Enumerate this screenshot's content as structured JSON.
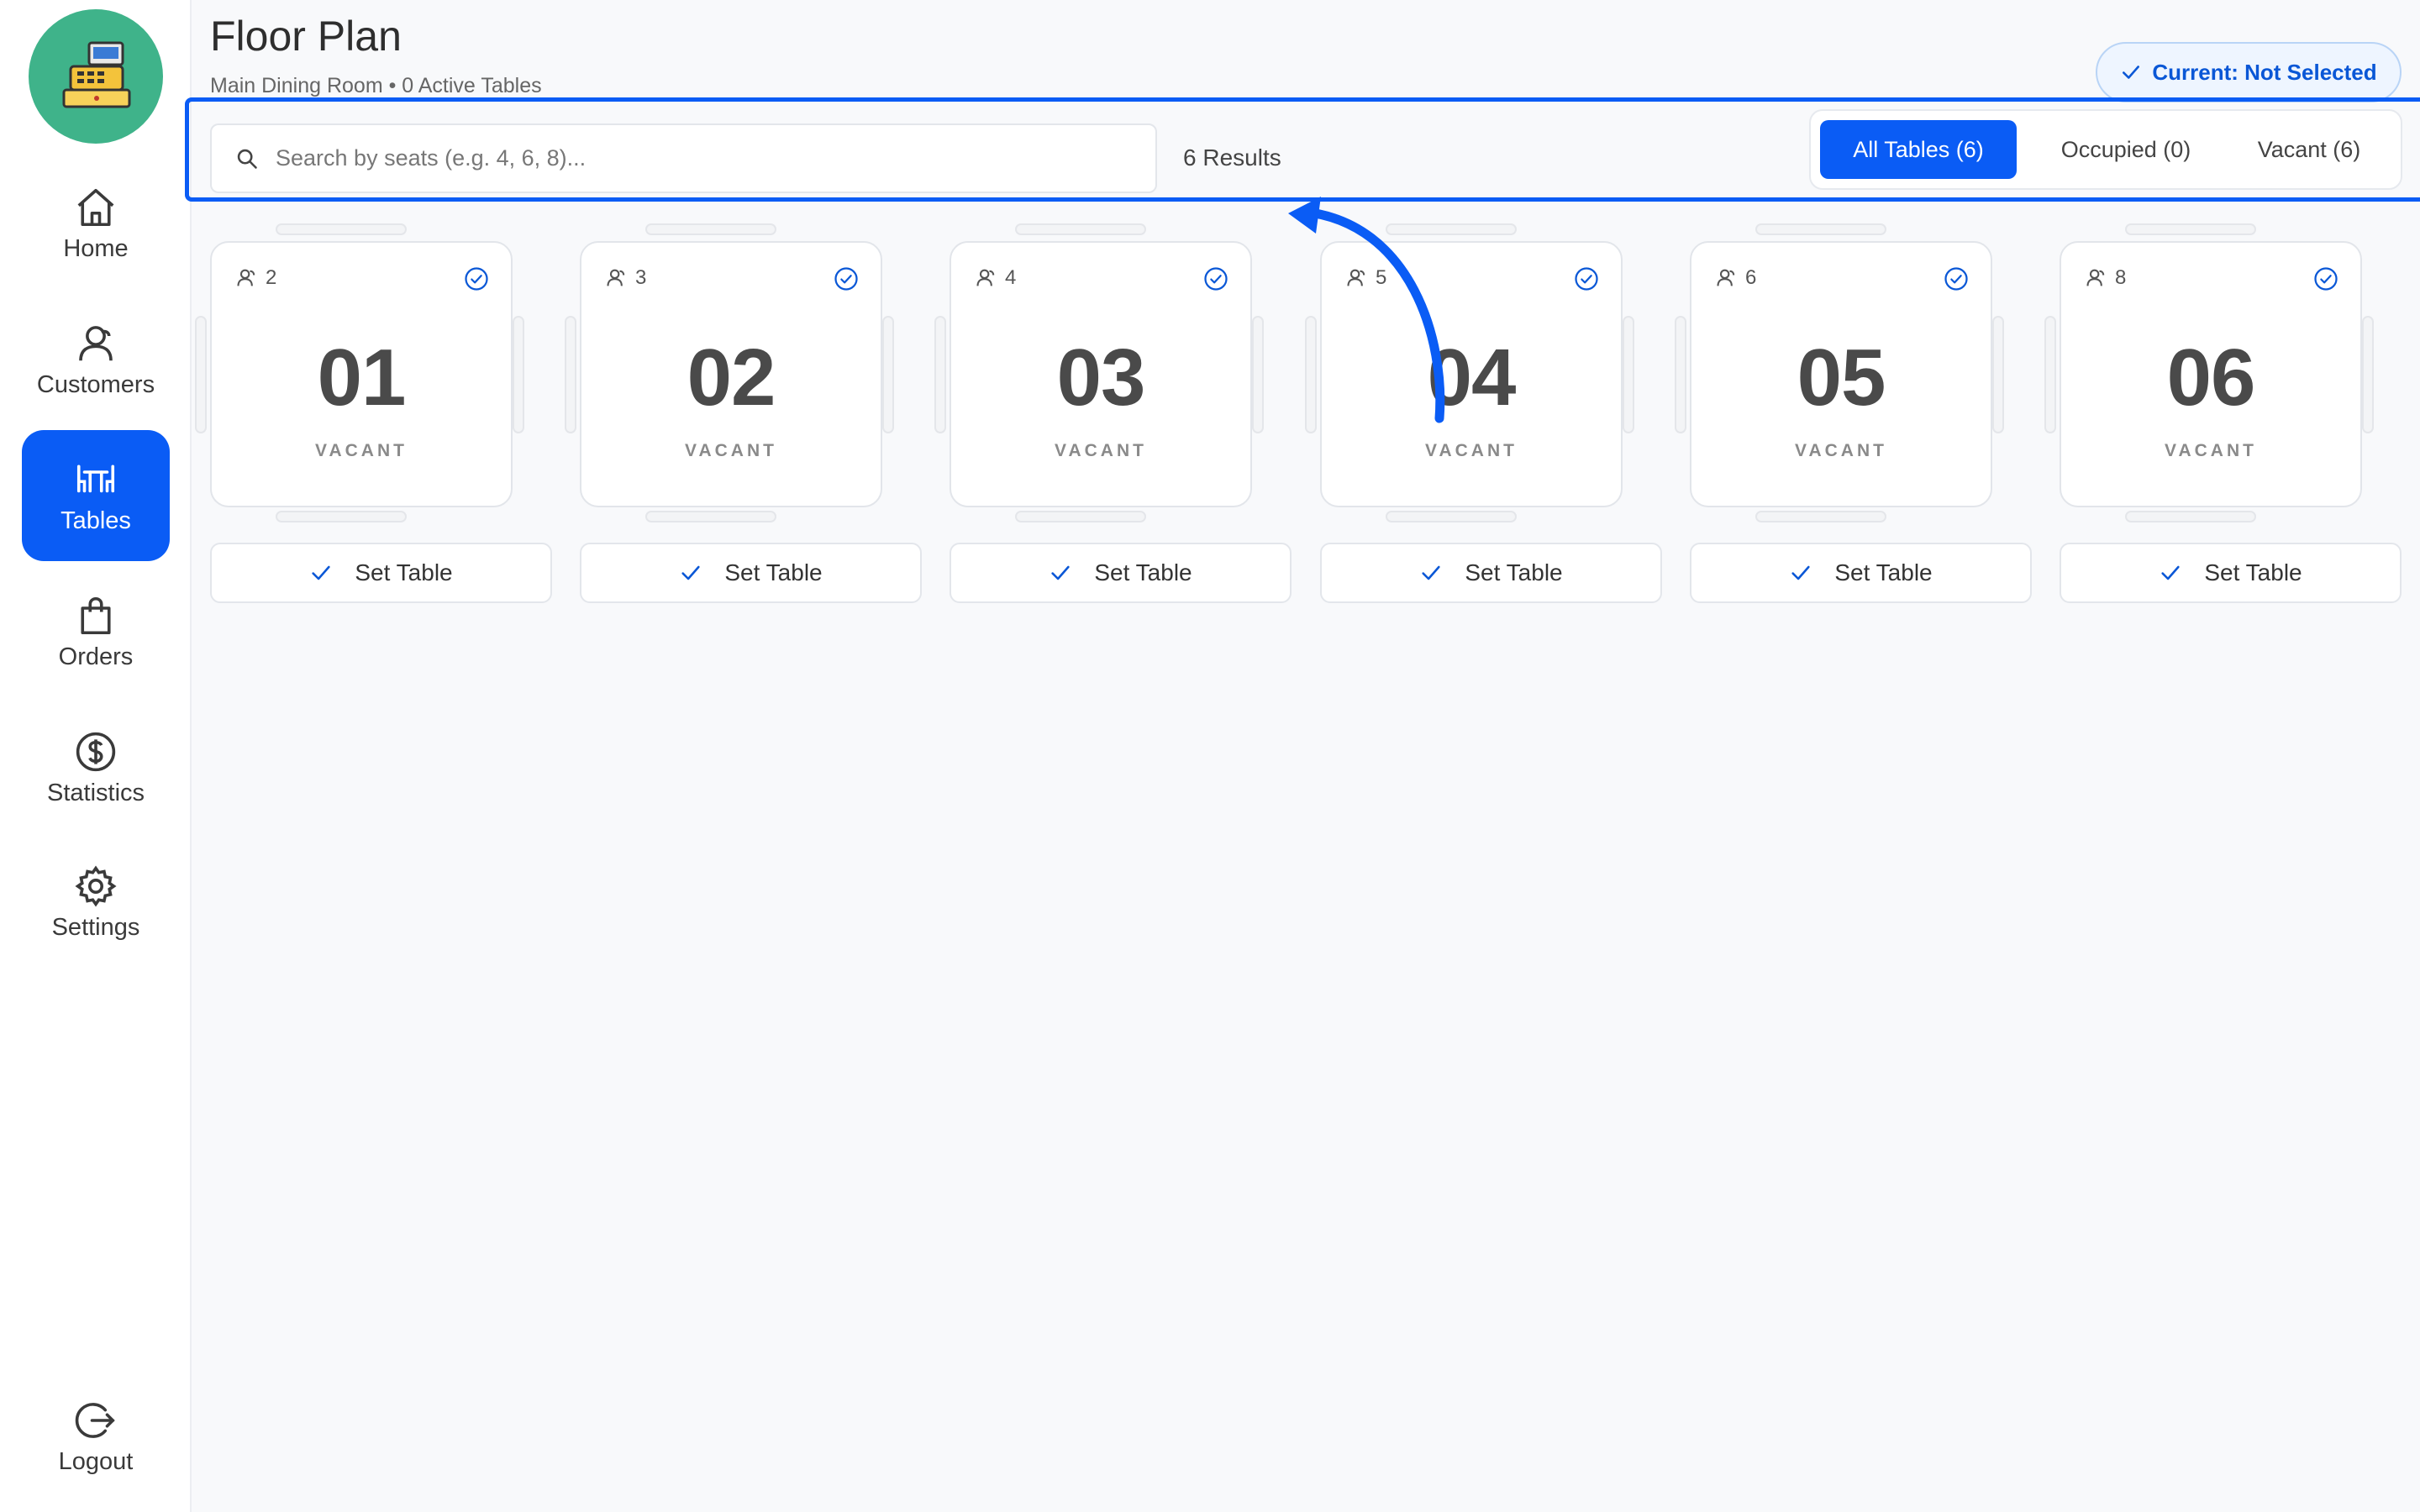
{
  "sidebar": {
    "logo_icon": "cash-register-icon",
    "items": [
      {
        "label": "Home",
        "icon": "home-icon"
      },
      {
        "label": "Customers",
        "icon": "customers-icon"
      },
      {
        "label": "Tables",
        "icon": "tables-icon",
        "active": true
      },
      {
        "label": "Orders",
        "icon": "bag-icon"
      },
      {
        "label": "Statistics",
        "icon": "dollar-circle-icon"
      },
      {
        "label": "Settings",
        "icon": "gear-icon"
      }
    ],
    "logout": {
      "label": "Logout",
      "icon": "logout-icon"
    }
  },
  "header": {
    "title": "Floor Plan",
    "subtitle": "Main Dining Room • 0 Active Tables",
    "current_badge": "Current: Not Selected"
  },
  "toolbar": {
    "search_placeholder": "Search by seats (e.g. 4, 6, 8)...",
    "search_value": "",
    "results": "6 Results",
    "filters": [
      {
        "label": "All Tables (6)",
        "active": true
      },
      {
        "label": "Occupied (0)",
        "active": false
      },
      {
        "label": "Vacant (6)",
        "active": false
      }
    ]
  },
  "tables": [
    {
      "number": "01",
      "seats": "2",
      "status": "VACANT",
      "action": "Set Table"
    },
    {
      "number": "02",
      "seats": "3",
      "status": "VACANT",
      "action": "Set Table"
    },
    {
      "number": "03",
      "seats": "4",
      "status": "VACANT",
      "action": "Set Table"
    },
    {
      "number": "04",
      "seats": "5",
      "status": "VACANT",
      "action": "Set Table"
    },
    {
      "number": "05",
      "seats": "6",
      "status": "VACANT",
      "action": "Set Table"
    },
    {
      "number": "06",
      "seats": "8",
      "status": "VACANT",
      "action": "Set Table"
    }
  ],
  "colors": {
    "accent": "#0a5cf5",
    "logo_bg": "#3fb38a",
    "background": "#f8f9fb"
  }
}
